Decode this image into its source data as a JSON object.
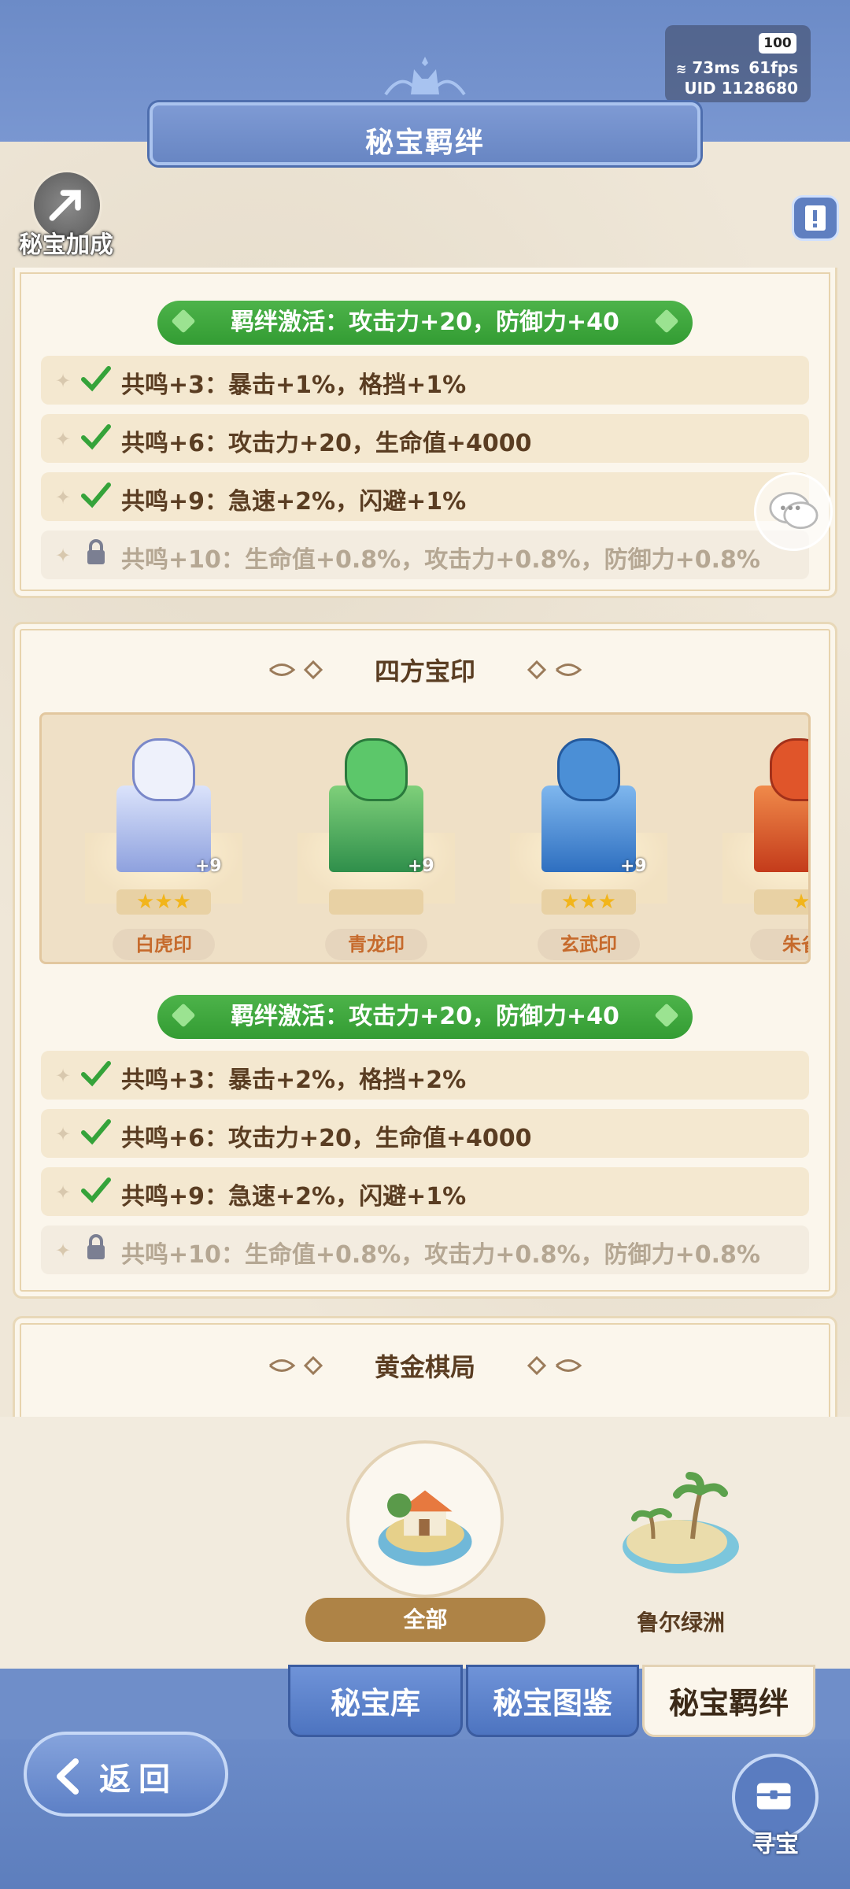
{
  "status": {
    "battery": "100",
    "ping": "73ms",
    "fps": "61fps",
    "uid": "UID 1128680"
  },
  "header": {
    "title": "秘宝羁绊"
  },
  "side": {
    "bonus_label": "秘宝加成"
  },
  "sections": [
    {
      "title": "",
      "activation": "羁绊激活：攻击力+20，防御力+40",
      "rows": [
        {
          "text": "共鸣+3：暴击+1%，格挡+1%",
          "state": "unlocked"
        },
        {
          "text": "共鸣+6：攻击力+20，生命值+4000",
          "state": "unlocked"
        },
        {
          "text": "共鸣+9：急速+2%，闪避+1%",
          "state": "unlocked"
        },
        {
          "text": "共鸣+10：生命值+0.8%，攻击力+0.8%，防御力+0.8%",
          "state": "locked"
        }
      ]
    },
    {
      "title": "四方宝印",
      "seals": [
        {
          "name": "白虎印",
          "plus": "+9",
          "stars": "★★★",
          "color": "#a9b8e8"
        },
        {
          "name": "青龙印",
          "plus": "+9",
          "stars": "",
          "color": "#3fae5f"
        },
        {
          "name": "玄武印",
          "plus": "+9",
          "stars": "★★★",
          "color": "#4b8fd6"
        },
        {
          "name": "朱雀",
          "plus": "",
          "stars": "★",
          "color": "#e0552a"
        }
      ],
      "activation": "羁绊激活：攻击力+20，防御力+40",
      "rows": [
        {
          "text": "共鸣+3：暴击+2%，格挡+2%",
          "state": "unlocked"
        },
        {
          "text": "共鸣+6：攻击力+20，生命值+4000",
          "state": "unlocked"
        },
        {
          "text": "共鸣+9：急速+2%，闪避+1%",
          "state": "unlocked"
        },
        {
          "text": "共鸣+10：生命值+0.8%，攻击力+0.8%，防御力+0.8%",
          "state": "locked"
        }
      ]
    },
    {
      "title": "黄金棋局"
    }
  ],
  "regions": {
    "all": "全部",
    "oasis": "鲁尔绿洲"
  },
  "tabs": [
    {
      "label": "秘宝库"
    },
    {
      "label": "秘宝图鉴"
    },
    {
      "label": "秘宝羁绊"
    }
  ],
  "footer": {
    "back": "返回",
    "treasure": "寻宝"
  },
  "colors": {
    "accent_blue": "#6f8ec9",
    "activation_green": "#3fa83d",
    "parchment": "#fbf6ec"
  }
}
